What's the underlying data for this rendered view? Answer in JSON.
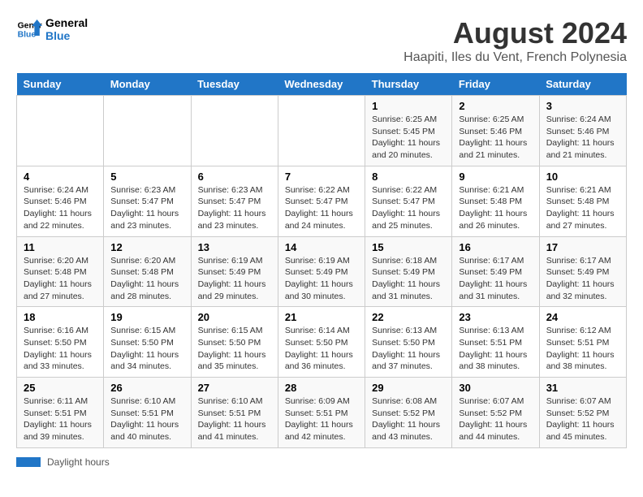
{
  "header": {
    "logo_line1": "General",
    "logo_line2": "Blue",
    "title": "August 2024",
    "subtitle": "Haapiti, Iles du Vent, French Polynesia"
  },
  "days_of_week": [
    "Sunday",
    "Monday",
    "Tuesday",
    "Wednesday",
    "Thursday",
    "Friday",
    "Saturday"
  ],
  "weeks": [
    [
      {
        "day": "",
        "info": ""
      },
      {
        "day": "",
        "info": ""
      },
      {
        "day": "",
        "info": ""
      },
      {
        "day": "",
        "info": ""
      },
      {
        "day": "1",
        "info": "Sunrise: 6:25 AM\nSunset: 5:45 PM\nDaylight: 11 hours and 20 minutes."
      },
      {
        "day": "2",
        "info": "Sunrise: 6:25 AM\nSunset: 5:46 PM\nDaylight: 11 hours and 21 minutes."
      },
      {
        "day": "3",
        "info": "Sunrise: 6:24 AM\nSunset: 5:46 PM\nDaylight: 11 hours and 21 minutes."
      }
    ],
    [
      {
        "day": "4",
        "info": "Sunrise: 6:24 AM\nSunset: 5:46 PM\nDaylight: 11 hours and 22 minutes."
      },
      {
        "day": "5",
        "info": "Sunrise: 6:23 AM\nSunset: 5:47 PM\nDaylight: 11 hours and 23 minutes."
      },
      {
        "day": "6",
        "info": "Sunrise: 6:23 AM\nSunset: 5:47 PM\nDaylight: 11 hours and 23 minutes."
      },
      {
        "day": "7",
        "info": "Sunrise: 6:22 AM\nSunset: 5:47 PM\nDaylight: 11 hours and 24 minutes."
      },
      {
        "day": "8",
        "info": "Sunrise: 6:22 AM\nSunset: 5:47 PM\nDaylight: 11 hours and 25 minutes."
      },
      {
        "day": "9",
        "info": "Sunrise: 6:21 AM\nSunset: 5:48 PM\nDaylight: 11 hours and 26 minutes."
      },
      {
        "day": "10",
        "info": "Sunrise: 6:21 AM\nSunset: 5:48 PM\nDaylight: 11 hours and 27 minutes."
      }
    ],
    [
      {
        "day": "11",
        "info": "Sunrise: 6:20 AM\nSunset: 5:48 PM\nDaylight: 11 hours and 27 minutes."
      },
      {
        "day": "12",
        "info": "Sunrise: 6:20 AM\nSunset: 5:48 PM\nDaylight: 11 hours and 28 minutes."
      },
      {
        "day": "13",
        "info": "Sunrise: 6:19 AM\nSunset: 5:49 PM\nDaylight: 11 hours and 29 minutes."
      },
      {
        "day": "14",
        "info": "Sunrise: 6:19 AM\nSunset: 5:49 PM\nDaylight: 11 hours and 30 minutes."
      },
      {
        "day": "15",
        "info": "Sunrise: 6:18 AM\nSunset: 5:49 PM\nDaylight: 11 hours and 31 minutes."
      },
      {
        "day": "16",
        "info": "Sunrise: 6:17 AM\nSunset: 5:49 PM\nDaylight: 11 hours and 31 minutes."
      },
      {
        "day": "17",
        "info": "Sunrise: 6:17 AM\nSunset: 5:49 PM\nDaylight: 11 hours and 32 minutes."
      }
    ],
    [
      {
        "day": "18",
        "info": "Sunrise: 6:16 AM\nSunset: 5:50 PM\nDaylight: 11 hours and 33 minutes."
      },
      {
        "day": "19",
        "info": "Sunrise: 6:15 AM\nSunset: 5:50 PM\nDaylight: 11 hours and 34 minutes."
      },
      {
        "day": "20",
        "info": "Sunrise: 6:15 AM\nSunset: 5:50 PM\nDaylight: 11 hours and 35 minutes."
      },
      {
        "day": "21",
        "info": "Sunrise: 6:14 AM\nSunset: 5:50 PM\nDaylight: 11 hours and 36 minutes."
      },
      {
        "day": "22",
        "info": "Sunrise: 6:13 AM\nSunset: 5:50 PM\nDaylight: 11 hours and 37 minutes."
      },
      {
        "day": "23",
        "info": "Sunrise: 6:13 AM\nSunset: 5:51 PM\nDaylight: 11 hours and 38 minutes."
      },
      {
        "day": "24",
        "info": "Sunrise: 6:12 AM\nSunset: 5:51 PM\nDaylight: 11 hours and 38 minutes."
      }
    ],
    [
      {
        "day": "25",
        "info": "Sunrise: 6:11 AM\nSunset: 5:51 PM\nDaylight: 11 hours and 39 minutes."
      },
      {
        "day": "26",
        "info": "Sunrise: 6:10 AM\nSunset: 5:51 PM\nDaylight: 11 hours and 40 minutes."
      },
      {
        "day": "27",
        "info": "Sunrise: 6:10 AM\nSunset: 5:51 PM\nDaylight: 11 hours and 41 minutes."
      },
      {
        "day": "28",
        "info": "Sunrise: 6:09 AM\nSunset: 5:51 PM\nDaylight: 11 hours and 42 minutes."
      },
      {
        "day": "29",
        "info": "Sunrise: 6:08 AM\nSunset: 5:52 PM\nDaylight: 11 hours and 43 minutes."
      },
      {
        "day": "30",
        "info": "Sunrise: 6:07 AM\nSunset: 5:52 PM\nDaylight: 11 hours and 44 minutes."
      },
      {
        "day": "31",
        "info": "Sunrise: 6:07 AM\nSunset: 5:52 PM\nDaylight: 11 hours and 45 minutes."
      }
    ]
  ],
  "footer": {
    "label": "Daylight hours"
  }
}
